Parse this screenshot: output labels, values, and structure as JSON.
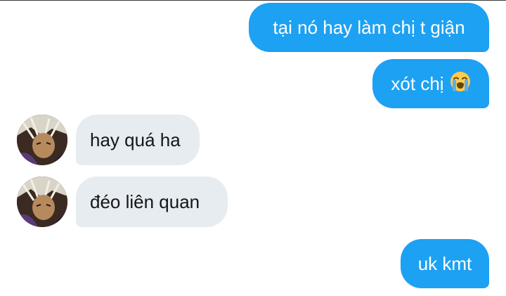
{
  "conversation": {
    "messages": [
      {
        "direction": "sent",
        "text": "tại nó hay làm chị t giận"
      },
      {
        "direction": "sent",
        "text": "xót chị",
        "emoji": "loudly-crying-face-icon"
      },
      {
        "direction": "received",
        "text": "hay quá ha",
        "avatar": "contact-avatar"
      },
      {
        "direction": "received",
        "text": "đéo liên quan",
        "avatar": "contact-avatar"
      },
      {
        "direction": "sent",
        "text": "uk kmt"
      }
    ]
  },
  "colors": {
    "sent_bubble": "#1da1f2",
    "received_bubble": "#e6ecf0",
    "sent_text": "#ffffff",
    "received_text": "#14171a"
  }
}
